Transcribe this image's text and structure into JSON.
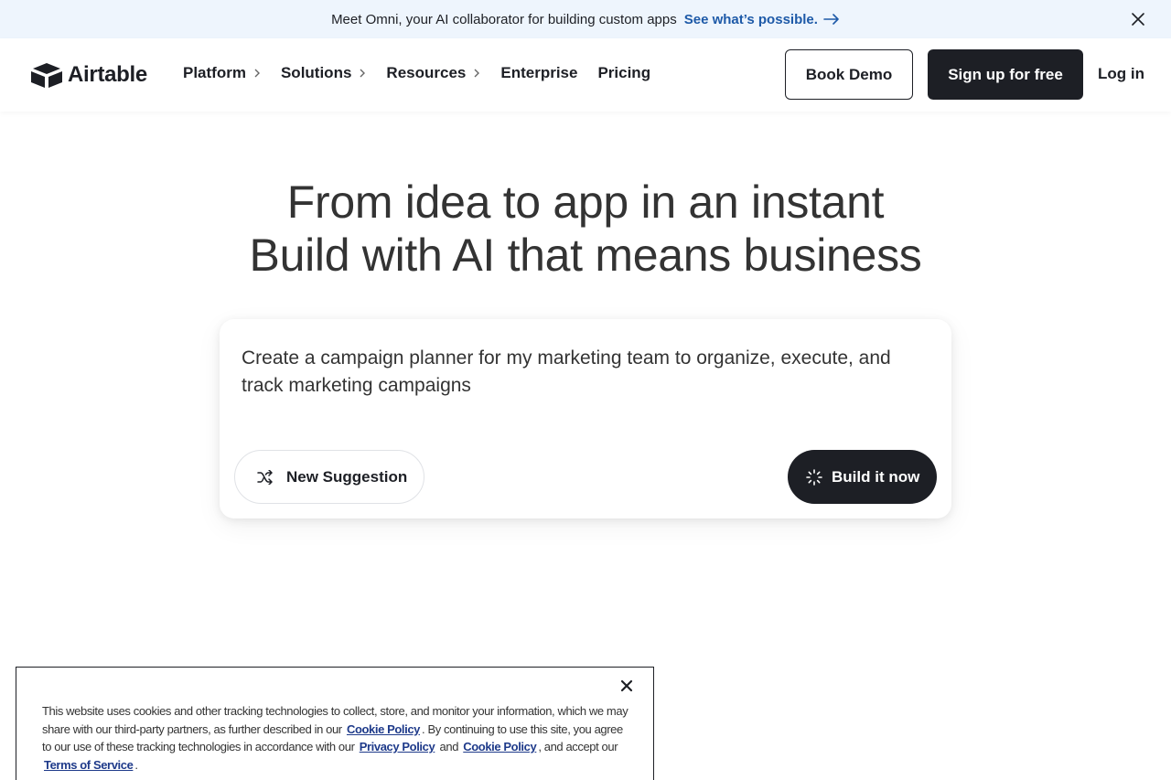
{
  "banner": {
    "text": "Meet Omni, your AI collaborator for building custom apps",
    "link": "See what’s possible."
  },
  "nav": {
    "logo": "Airtable",
    "items": [
      {
        "label": "Platform",
        "has_submenu": true
      },
      {
        "label": "Solutions",
        "has_submenu": true
      },
      {
        "label": "Resources",
        "has_submenu": true
      },
      {
        "label": "Enterprise",
        "has_submenu": false
      },
      {
        "label": "Pricing",
        "has_submenu": false
      }
    ],
    "book_demo": "Book Demo",
    "signup": "Sign up for free",
    "login": "Log in"
  },
  "hero": {
    "line1": "From idea to app in an instant",
    "line2": "Build with AI that means business"
  },
  "prompt": {
    "text": "Create a campaign planner for my marketing team to organize, execute, and track marketing campaigns",
    "suggest_label": "New Suggestion",
    "build_label": "Build it now"
  },
  "cookie": {
    "t1": "This website uses cookies and other tracking technologies to collect, store, and monitor your information, which we may share with our third-party partners, as further described in our",
    "link1": "Cookie Policy",
    "t2": ". By continuing to use this site, you agree to our use of these tracking technologies in accordance with our",
    "link2": "Privacy Policy",
    "t3": "and",
    "link3": "Cookie Policy",
    "t4": ", and accept our",
    "link4": "Terms of Service",
    "t5": "."
  },
  "colors": {
    "banner_bg": "#eef5fd",
    "banner_link": "#1e5aa8",
    "dark": "#1d1f25",
    "cookie_link": "#1e3a8a"
  }
}
